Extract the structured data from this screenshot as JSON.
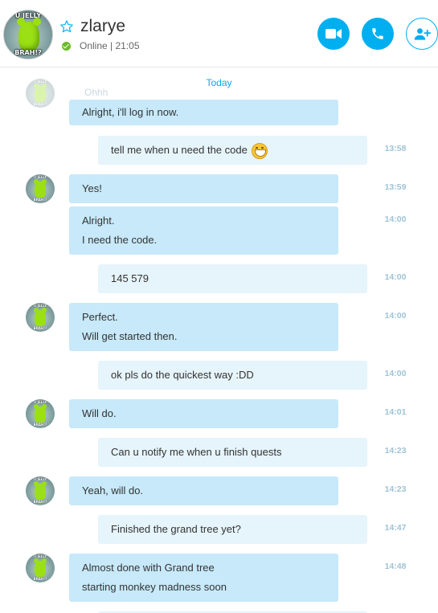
{
  "header": {
    "contact_name": "zlarye",
    "status": "Online | 21:05",
    "avatar_caption_top": "U JELLY",
    "avatar_caption_bottom": "BRAH!?",
    "accent_color": "#00aff0",
    "status_color": "#6cbb2a",
    "buttons": [
      {
        "name": "video-call",
        "icon": "video-camera-icon"
      },
      {
        "name": "audio-call",
        "icon": "phone-icon"
      },
      {
        "name": "add-contact",
        "icon": "add-person-icon"
      }
    ]
  },
  "chat": {
    "date_divider": "Today",
    "ghost_top": "Ohhh",
    "messages": [
      {
        "from": "them",
        "lines": [
          "Alright, i'll log in now."
        ],
        "time": ""
      },
      {
        "from": "me",
        "lines": [
          "tell me when u need the code"
        ],
        "emoji": "grin",
        "time": "13:58"
      },
      {
        "from": "them",
        "lines": [
          "Yes!"
        ],
        "time": "13:59"
      },
      {
        "from": "them",
        "lines": [
          "Alright.",
          "I need the code."
        ],
        "time": "14:00"
      },
      {
        "from": "me",
        "lines": [
          "145 579"
        ],
        "time": "14:00"
      },
      {
        "from": "them",
        "lines": [
          "Perfect.",
          "Will get started then."
        ],
        "time": "14:00"
      },
      {
        "from": "me",
        "lines": [
          "ok pls do the quickest way :DD"
        ],
        "time": "14:00"
      },
      {
        "from": "them",
        "lines": [
          "Will do."
        ],
        "time": "14:01"
      },
      {
        "from": "me",
        "lines": [
          "Can u notify me when u finish quests"
        ],
        "time": "14:23"
      },
      {
        "from": "them",
        "lines": [
          "Yeah, will do."
        ],
        "time": "14:23"
      },
      {
        "from": "me",
        "lines": [
          "Finished the grand tree yet?"
        ],
        "time": "14:47"
      },
      {
        "from": "them",
        "lines": [
          "Almost done with Grand tree",
          "starting monkey madness soon"
        ],
        "time": "14:48"
      }
    ]
  }
}
